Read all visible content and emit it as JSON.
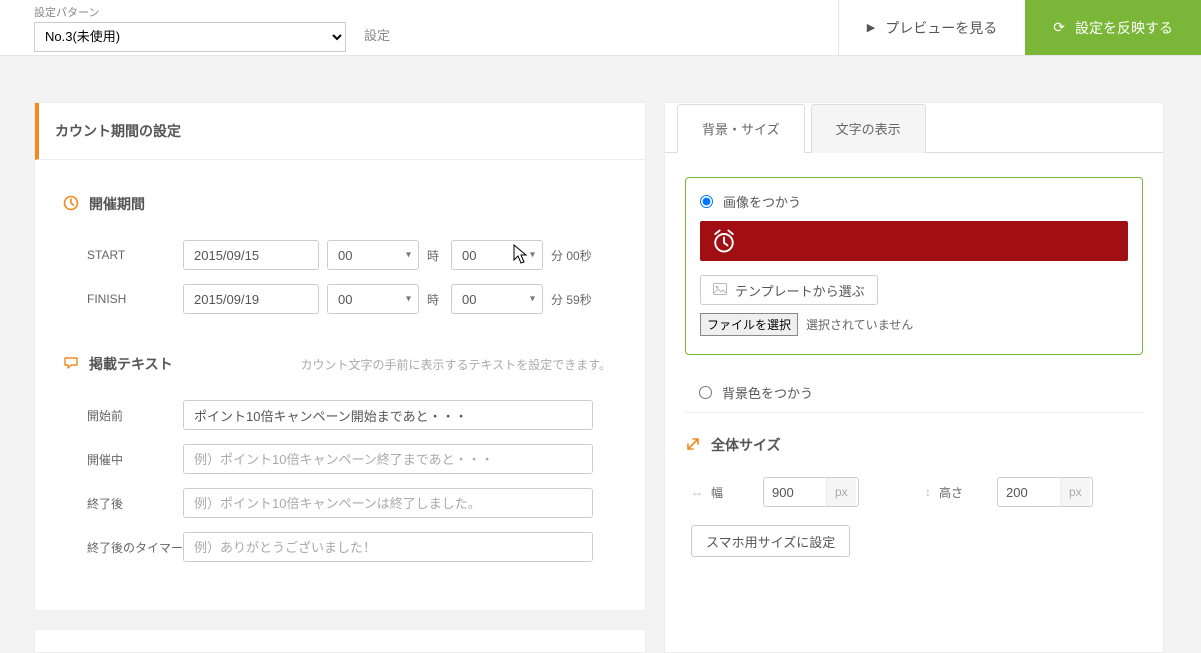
{
  "topbar": {
    "pattern_label": "設定パターン",
    "pattern_value": "No.3(未使用)",
    "settings_link": "設定",
    "preview_label": "プレビューを見る",
    "apply_label": "設定を反映する"
  },
  "left_panel": {
    "title": "カウント期間の設定",
    "period": {
      "heading": "開催期間",
      "start_label": "START",
      "finish_label": "FINISH",
      "start_date": "2015/09/15",
      "finish_date": "2015/09/19",
      "start_hour": "00",
      "finish_hour": "00",
      "start_min": "00",
      "finish_min": "00",
      "hour_unit": "時",
      "start_min_suffix": "分 00秒",
      "finish_min_suffix": "分 59秒"
    },
    "texts": {
      "heading": "掲載テキスト",
      "hint": "カウント文字の手前に表示するテキストを設定できます。",
      "before_label": "開始前",
      "during_label": "開催中",
      "after_label": "終了後",
      "after_timer_label": "終了後のタイマー",
      "before_value": "ポイント10倍キャンペーン開始まであと・・・",
      "during_placeholder": "例）ポイント10倍キャンペーン終了まであと・・・",
      "after_placeholder": "例）ポイント10倍キャンペーンは終了しました。",
      "after_timer_placeholder": "例）ありがとうございました！"
    }
  },
  "right_panel": {
    "tabs": {
      "bg": "背景・サイズ",
      "text": "文字の表示"
    },
    "bg": {
      "use_image": "画像をつかう",
      "use_bgcolor": "背景色をつかう",
      "template_btn": "テンプレートから選ぶ",
      "file_btn": "ファイルを選択",
      "file_status": "選択されていません",
      "preview_color": "#a20f12"
    },
    "size": {
      "heading": "全体サイズ",
      "width_label": "幅",
      "height_label": "高さ",
      "width_value": "900",
      "height_value": "200",
      "px": "px",
      "sp_btn": "スマホ用サイズに設定"
    }
  }
}
